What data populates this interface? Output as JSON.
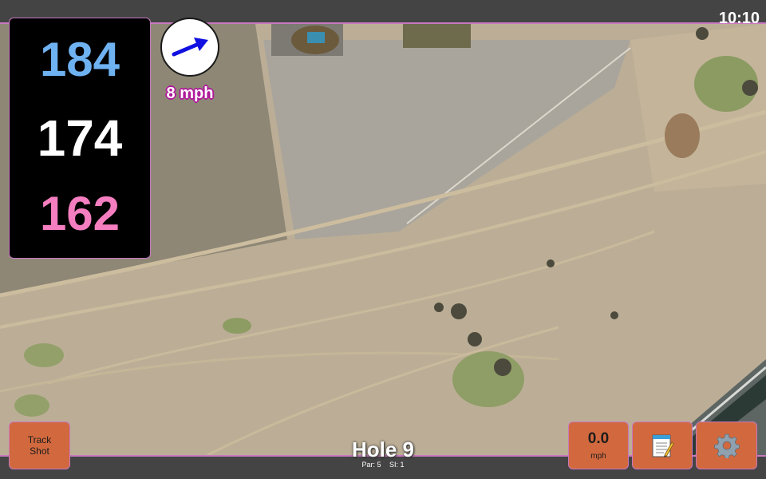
{
  "status_bar": {
    "time": "10:10"
  },
  "distances": {
    "back": "184",
    "middle": "174",
    "front": "162"
  },
  "wind": {
    "speed_label": "8 mph",
    "direction_icon": "arrow-icon"
  },
  "buttons": {
    "track_shot_line1": "Track",
    "track_shot_line2": "Shot",
    "speed_value": "0.0",
    "speed_unit": "mph",
    "notes_icon": "notepad-icon",
    "settings_icon": "gear-icon"
  },
  "hole": {
    "title": "Hole 9",
    "par": "Par: 5",
    "si": "SI: 1"
  },
  "colors": {
    "back_distance": "#6fb2f2",
    "middle_distance": "#ffffff",
    "front_distance": "#f47ec0",
    "button_fill": "#d2693e",
    "accent_border": "#c878c0"
  }
}
